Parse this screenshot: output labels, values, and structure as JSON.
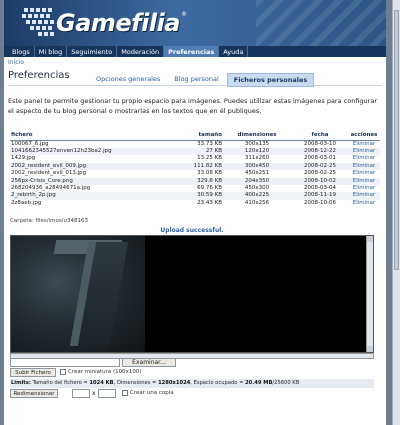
{
  "site": {
    "logo_text": "Gamefilia",
    "logo_mark": "®"
  },
  "nav": {
    "items": [
      {
        "label": "Blogs",
        "active": false
      },
      {
        "label": "Mi blog",
        "active": false
      },
      {
        "label": "Seguimiento",
        "active": false
      },
      {
        "label": "Moderación",
        "active": false
      },
      {
        "label": "Preferencias",
        "active": true
      },
      {
        "label": "Ayuda",
        "active": false
      }
    ]
  },
  "breadcrumb": "Inicio",
  "page_title": "Preferencias",
  "tabs": [
    {
      "label": "Opciones generales",
      "active": false
    },
    {
      "label": "Blog personal",
      "active": false
    },
    {
      "label": "Ficheros personales",
      "active": true
    }
  ],
  "intro_text": "Este panel te permite gestionar tu propio espacio para imágenes. Puedes utilizar estas imágenes para configurar el aspecto de tu blog personal o mostrarlas en los textos que en él publiques.",
  "files_table": {
    "headers": {
      "name": "fichero",
      "size": "tamaño",
      "dimensions": "dimensiones",
      "date": "fecha",
      "actions": "acciones"
    },
    "rows": [
      {
        "name": "100067_6.jpg",
        "size": "33.73 KB",
        "dimensions": "300x135",
        "date": "2008-03-10",
        "action": "Eliminar"
      },
      {
        "name": "1041662345527enven12h23ba2.jpg",
        "size": "27 KB",
        "dimensions": "120x120",
        "date": "2008-12-22",
        "action": "Eliminar"
      },
      {
        "name": "1429.jpg",
        "size": "13.25 KB",
        "dimensions": "311x260",
        "date": "2008-03-01",
        "action": "Eliminar"
      },
      {
        "name": "2002_resident_evil_009.jpg",
        "size": "111.82 KB",
        "dimensions": "300x450",
        "date": "2008-02-25",
        "action": "Eliminar"
      },
      {
        "name": "2002_resident_evil_013.jpg",
        "size": "33.08 KB",
        "dimensions": "450x251",
        "date": "2008-02-25",
        "action": "Eliminar"
      },
      {
        "name": "256px-Crisis_Core.png",
        "size": "329.6 KB",
        "dimensions": "204x350",
        "date": "2008-10-02",
        "action": "Eliminar"
      },
      {
        "name": "268204936_a28494671a.jpg",
        "size": "69.76 KB",
        "dimensions": "450x300",
        "date": "2008-03-04",
        "action": "Eliminar"
      },
      {
        "name": "2_rebirth_2p.jpg",
        "size": "30.59 KB",
        "dimensions": "400x225",
        "date": "2008-11-19",
        "action": "Eliminar"
      },
      {
        "name": "2z8aeb.jpg",
        "size": "23.43 KB",
        "dimensions": "410x256",
        "date": "2008-10-06",
        "action": "Eliminar"
      }
    ]
  },
  "folder_label": "Carpeta: files/imos/u348163",
  "upload_status": "Upload successful.",
  "upload": {
    "browse_label": "Examinar...",
    "submit_label": "Subir Fichero",
    "thumb_checkbox_label": "Crear miniatura (100x100)"
  },
  "limits": {
    "label": "Limits:",
    "size_text": "Tamaño del fichero = ",
    "size_value": "1024 KB",
    "dims_text": ", Dimensiones = ",
    "dims_value": "1280x1024",
    "space_text": ", Espacio ocupado = ",
    "space_value": "20.49 MB",
    "space_total": "/25600 KB"
  },
  "resize": {
    "button_label": "Redimensionar",
    "x_separator": "x",
    "copy_checkbox_label": "Crear una copia"
  },
  "colors": {
    "header_bg": "#2d5688",
    "nav_bg": "#17365e",
    "nav_active": "#4f7db5",
    "link": "#2e5e98",
    "success": "#2a5fb0"
  }
}
